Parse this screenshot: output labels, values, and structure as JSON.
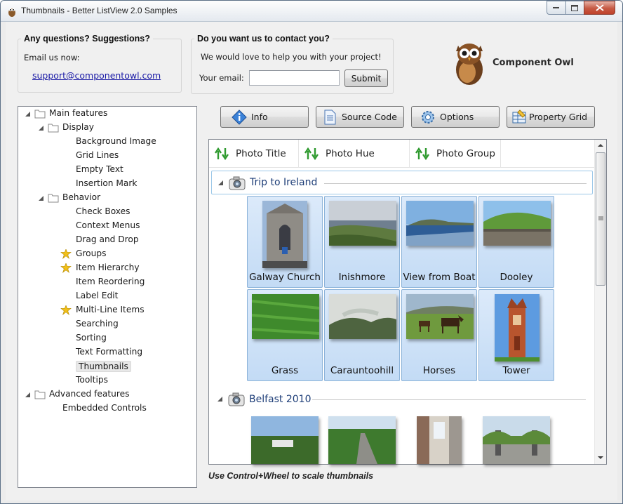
{
  "window": {
    "title": "Thumbnails - Better ListView 2.0 Samples"
  },
  "questions": {
    "heading": "Any questions? Suggestions?",
    "email_label": "Email us now:",
    "email_link": "support@componentowl.com"
  },
  "contact": {
    "heading": "Do you want us to contact you?",
    "message": "We would love to help you with your project!",
    "email_label": "Your email:",
    "email_value": "",
    "submit_label": "Submit"
  },
  "brand": {
    "name": "Component Owl"
  },
  "tree": {
    "nodes": [
      {
        "label": "Main features"
      },
      {
        "label": "Display"
      },
      {
        "label": "Background Image"
      },
      {
        "label": "Grid Lines"
      },
      {
        "label": "Empty Text"
      },
      {
        "label": "Insertion Mark"
      },
      {
        "label": "Behavior"
      },
      {
        "label": "Check Boxes"
      },
      {
        "label": "Context Menus"
      },
      {
        "label": "Drag and Drop"
      },
      {
        "label": "Groups"
      },
      {
        "label": "Item Hierarchy"
      },
      {
        "label": "Item Reordering"
      },
      {
        "label": "Label Edit"
      },
      {
        "label": "Multi-Line Items"
      },
      {
        "label": "Searching"
      },
      {
        "label": "Sorting"
      },
      {
        "label": "Text Formatting"
      },
      {
        "label": "Thumbnails"
      },
      {
        "label": "Tooltips"
      },
      {
        "label": "Advanced features"
      },
      {
        "label": "Embedded Controls"
      }
    ]
  },
  "toolbar": {
    "info": "Info",
    "source": "Source Code",
    "options": "Options",
    "property_grid": "Property Grid"
  },
  "listview": {
    "columns": [
      "Photo Title",
      "Photo Hue",
      "Photo Group"
    ],
    "groups": [
      {
        "title": "Trip to Ireland",
        "items": [
          "Galway Church",
          "Inishmore",
          "View from Boat",
          "Dooley",
          "Grass",
          "Carauntoohill",
          "Horses",
          "Tower"
        ]
      },
      {
        "title": "Belfast 2010",
        "items": [
          "",
          "",
          "",
          ""
        ]
      }
    ]
  },
  "hint": "Use Control+Wheel to scale thumbnails",
  "colors": {
    "selection": "#c9def5",
    "group_text": "#1e3e78",
    "link": "#1a1aa6"
  }
}
